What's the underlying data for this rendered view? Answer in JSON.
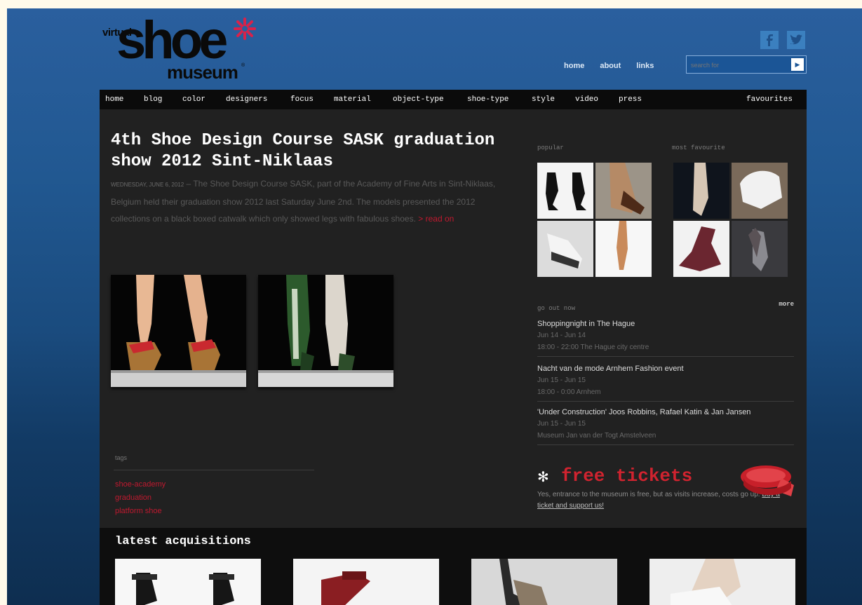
{
  "logo": {
    "word_virtual": "virtual",
    "word_shoe": "shoe",
    "word_museum": "museum",
    "registered": "®"
  },
  "header": {
    "social_icons": [
      "facebook-icon",
      "twitter-icon"
    ],
    "links": [
      "home",
      "about",
      "links"
    ],
    "search_placeholder": "search for",
    "search_go": "▶"
  },
  "nav": {
    "items": [
      "home",
      "blog",
      "color",
      "designers",
      "focus",
      "material",
      "object-type",
      "shoe-type",
      "style",
      "video",
      "press"
    ],
    "favourites": "favourites"
  },
  "article": {
    "title": "4th Shoe Design Course SASK graduation show 2012 Sint-Niklaas",
    "date": "WEDNESDAY, JUNE 6, 2012",
    "excerpt": "– The Shoe Design Course SASK, part of the Academy of Fine Arts in Sint-Niklaas, Belgium held their graduation show 2012 last Saturday June 2nd. The models presented the 2012 collections on a black boxed catwalk which only showed legs with fabulous shoes.",
    "read_more": "> read on"
  },
  "tags": {
    "label": "tags",
    "items": [
      "shoe-academy",
      "graduation",
      "platform shoe"
    ]
  },
  "sidebar": {
    "popular_label": "popular",
    "most_favourite_label": "most favourite",
    "today_label": "go out now",
    "more": "more",
    "events": [
      {
        "title": "Shoppingnight in The Hague",
        "dates": "Jun 14 - Jun 14",
        "info": "18:00 - 22:00 The Hague city centre"
      },
      {
        "title": "Nacht van de mode Arnhem Fashion event",
        "dates": "Jun 15 - Jun 15",
        "info": "18:00 - 0:00 Arnhem"
      },
      {
        "title": "'Under Construction' Joos Robbins, Rafael Katin & Jan Jansen",
        "dates": "Jun 15 - Jun 15",
        "info": "Museum Jan van der Togt Amstelveen"
      }
    ],
    "tickets": {
      "heading": "free tickets",
      "body": "Yes, entrance to the museum is free, but as visits increase, costs go up.",
      "link": "Buy a ticket and support us!"
    }
  },
  "acquisitions": {
    "heading": "latest acquisitions"
  }
}
